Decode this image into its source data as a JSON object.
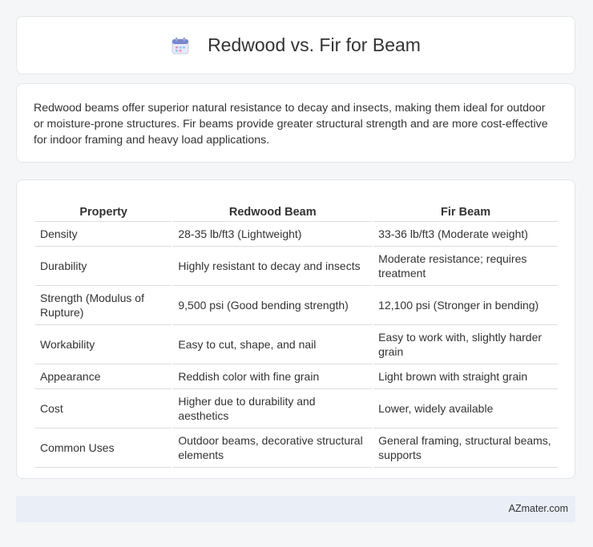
{
  "header": {
    "title": "Redwood vs. Fir for Beam",
    "icon": "calendar-icon"
  },
  "intro": {
    "text": "Redwood beams offer superior natural resistance to decay and insects, making them ideal for outdoor or moisture-prone structures. Fir beams provide greater structural strength and are more cost-effective for indoor framing and heavy load applications."
  },
  "table": {
    "headers": [
      "Property",
      "Redwood Beam",
      "Fir Beam"
    ],
    "rows": [
      [
        "Density",
        "28-35 lb/ft3 (Lightweight)",
        "33-36 lb/ft3 (Moderate weight)"
      ],
      [
        "Durability",
        "Highly resistant to decay and insects",
        "Moderate resistance; requires treatment"
      ],
      [
        "Strength (Modulus of Rupture)",
        "9,500 psi (Good bending strength)",
        "12,100 psi (Stronger in bending)"
      ],
      [
        "Workability",
        "Easy to cut, shape, and nail",
        "Easy to work with, slightly harder grain"
      ],
      [
        "Appearance",
        "Reddish color with fine grain",
        "Light brown with straight grain"
      ],
      [
        "Cost",
        "Higher due to durability and aesthetics",
        "Lower, widely available"
      ],
      [
        "Common Uses",
        "Outdoor beams, decorative structural elements",
        "General framing, structural beams, supports"
      ]
    ]
  },
  "footer": {
    "brand": "AZmater.com"
  }
}
